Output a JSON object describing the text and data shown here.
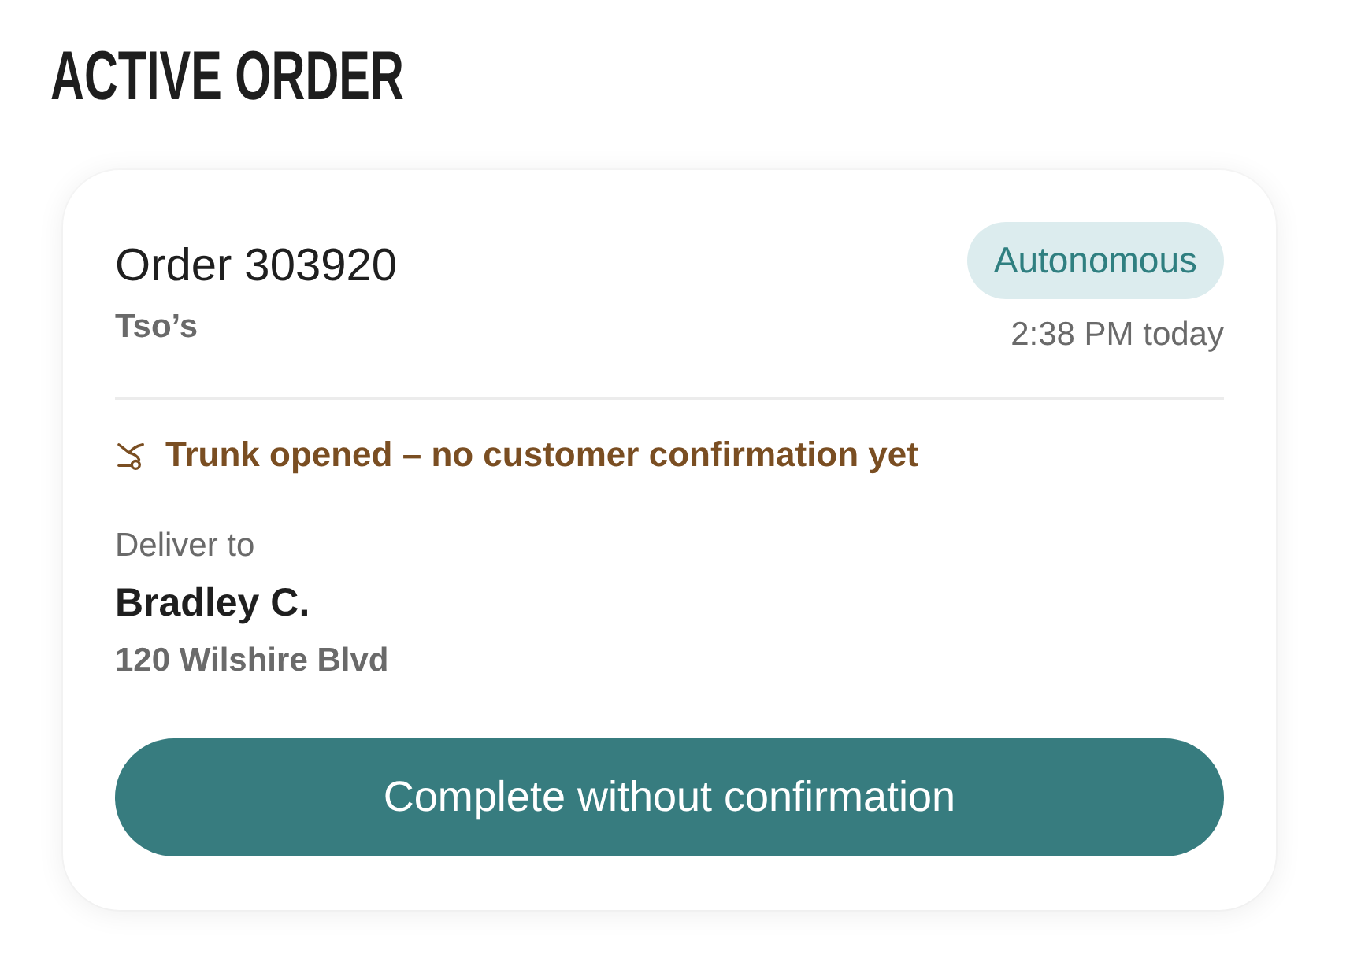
{
  "title": "ACTIVE ORDER",
  "order": {
    "number": "Order 303920",
    "restaurant": "Tso’s",
    "mode_badge": "Autonomous",
    "time": "2:38 PM today"
  },
  "alert": {
    "kind": "warning",
    "text": "Trunk opened – no customer confirmation yet"
  },
  "delivery": {
    "label": "Deliver to",
    "name": "Bradley C.",
    "address": "120 Wilshire Blvd"
  },
  "buttons": [
    {
      "label": "Complete without confirmation"
    }
  ]
}
